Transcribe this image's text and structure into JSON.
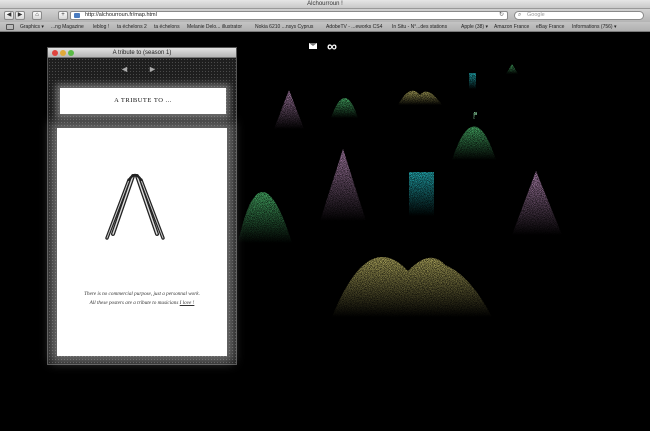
{
  "window": {
    "title": "Alchourroun !"
  },
  "toolbar": {
    "back_icon": "back-arrow-icon",
    "forward_icon": "forward-arrow-icon",
    "home_icon": "home-icon",
    "add_icon": "add-bookmark-icon",
    "url": "http://alchourroun.fr/map.html",
    "search_placeholder": "Google"
  },
  "bookmarks": [
    "Graphics ▾",
    "...ng Magazine",
    "leblog !",
    "ta échelons 2",
    "ta échelons",
    "Melanie Delo... illustrator",
    "Nokia 6210 ...nsys Cyprus",
    "AdobeTV - ...eworks CS4",
    "In Situ - N°...des stations",
    "Apple (38) ▾",
    "Amazon France",
    "eBay France",
    "Informations (756) ▾"
  ],
  "content": {
    "top_icons": [
      "mail-icon",
      "infinity-icon"
    ],
    "panel": {
      "title": "A tribute to (season 1)",
      "prev_label": "◄",
      "next_label": "►",
      "banner": "A TRIBUTE TO ...",
      "note_line1": "There is no commercial purpose, just a personnal work.",
      "note_line2": "All these posters are a tribute to musicians",
      "note_link": "I love !"
    }
  },
  "colors": {
    "pink": "#e6a6e6",
    "green": "#5be88a",
    "yellow": "#e8e07a",
    "cyan": "#2de6f0"
  }
}
